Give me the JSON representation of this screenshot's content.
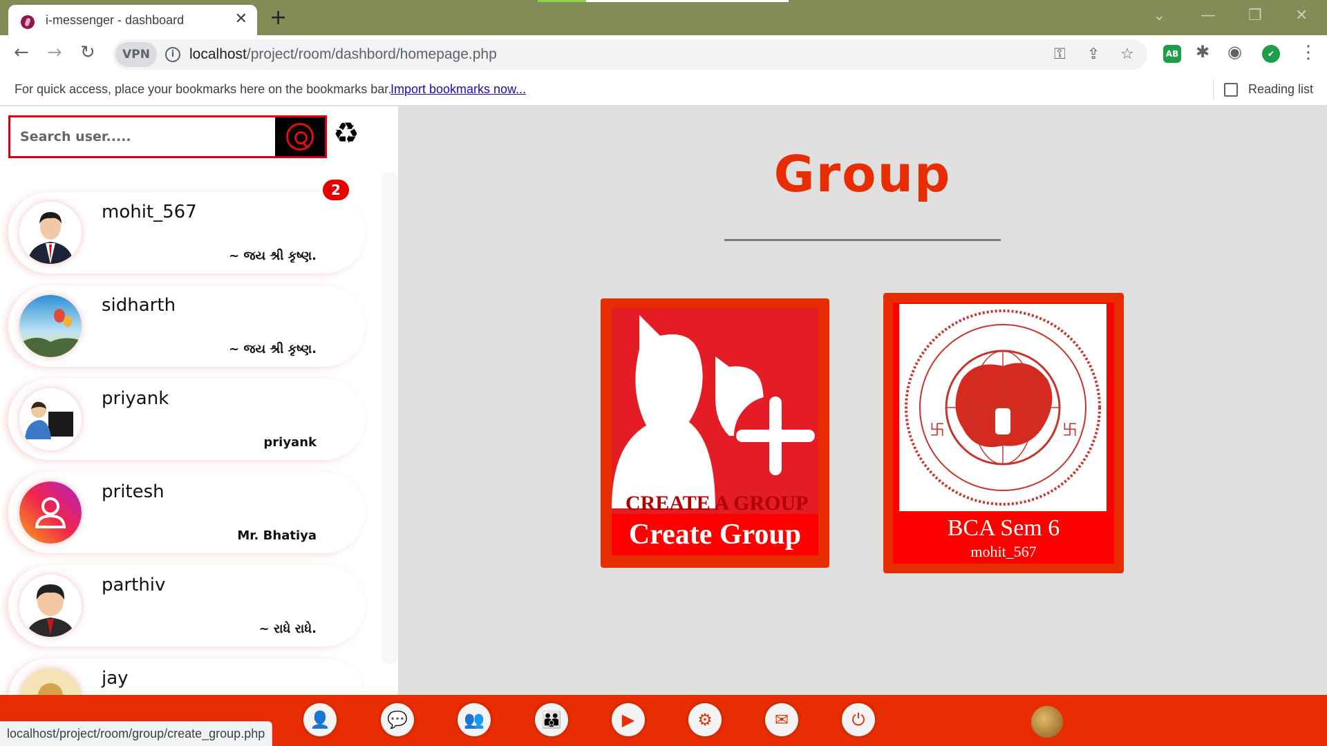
{
  "browser": {
    "tab_title": "i-messenger - dashboard",
    "vpn_label": "VPN",
    "url_host": "localhost",
    "url_path": "/project/room/dashbord/homepage.php",
    "bookmarks_text": "For quick access, place your bookmarks here on the bookmarks bar.",
    "bookmarks_link": "Import bookmarks now...",
    "reading_list": "Reading list",
    "status_url": "localhost/project/room/group/create_group.php",
    "extensions": [
      {
        "name": "adblock-icon",
        "label": "AB",
        "color": "#1e9e4a"
      },
      {
        "name": "shield-check-icon",
        "label": "✔",
        "color": "#1e9e4a"
      }
    ]
  },
  "search": {
    "placeholder": "Search user....."
  },
  "contacts": [
    {
      "name": "mohit_567",
      "status": "~ જય શ્રી કૃષ્ણ.",
      "badge": "2"
    },
    {
      "name": "sidharth",
      "status": "~ જય શ્રી કૃષ્ણ."
    },
    {
      "name": "priyank",
      "status": "priyank"
    },
    {
      "name": "pritesh",
      "status": "Mr. Bhatiya"
    },
    {
      "name": "parthiv",
      "status": "~ રાધે રાધે."
    },
    {
      "name": "jay",
      "status": ""
    }
  ],
  "main": {
    "title": "Group",
    "cards": [
      {
        "label": "Create Group",
        "art_text": "CREATE A GROUP"
      },
      {
        "label": "BCA Sem 6",
        "sublabel": "mohit_567"
      }
    ]
  },
  "dock": {
    "items": [
      {
        "name": "profile-icon",
        "glyph": "👤"
      },
      {
        "name": "chats-icon",
        "glyph": "💬"
      },
      {
        "name": "contacts-icon",
        "glyph": "👥"
      },
      {
        "name": "group-icon",
        "glyph": "👪"
      },
      {
        "name": "video-icon",
        "glyph": "▶"
      },
      {
        "name": "settings-icon",
        "glyph": "⚙"
      },
      {
        "name": "feedback-icon",
        "glyph": "✉"
      },
      {
        "name": "power-icon",
        "glyph": "⏻"
      }
    ]
  },
  "colors": {
    "accent": "#e82d02",
    "card_red": "#ff0000",
    "badge": "#e60000"
  }
}
